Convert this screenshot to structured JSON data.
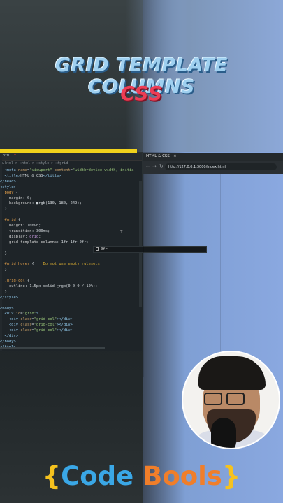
{
  "title": {
    "line1": "GRID TEMPLATE COLUMNS",
    "line2": "CSS"
  },
  "editor": {
    "tabs": [
      ".html",
      "x"
    ],
    "breadcrumb": "x.html > ☉html > ☉style > ☉#grid",
    "lines": [
      [
        {
          "c": "t-tag",
          "t": "  <meta "
        },
        {
          "c": "t-attr",
          "t": "name"
        },
        {
          "c": "",
          "t": "="
        },
        {
          "c": "t-str",
          "t": "\"viewport\""
        },
        {
          "c": "",
          "t": " "
        },
        {
          "c": "t-attr",
          "t": "content"
        },
        {
          "c": "",
          "t": "="
        },
        {
          "c": "t-str",
          "t": "\"width=device-width, initia"
        }
      ],
      [
        {
          "c": "t-tag",
          "t": "  <title>"
        },
        {
          "c": "",
          "t": "HTML & CSS"
        },
        {
          "c": "t-tag",
          "t": "</title>"
        }
      ],
      [
        {
          "c": "t-tag",
          "t": "</head>"
        }
      ],
      [
        {
          "c": "t-tag",
          "t": "<style>"
        }
      ],
      [
        {
          "c": "t-sel",
          "t": "  body"
        },
        {
          "c": "",
          "t": " {"
        }
      ],
      [
        {
          "c": "t-prop",
          "t": "    margin"
        },
        {
          "c": "",
          "t": ": 0;"
        }
      ],
      [
        {
          "c": "t-prop",
          "t": "    background"
        },
        {
          "c": "",
          "t": ": ■rgb(130, 180, 249);"
        }
      ],
      [
        {
          "c": "",
          "t": "  }"
        }
      ],
      [
        {
          "c": "",
          "t": ""
        }
      ],
      [
        {
          "c": "t-sel",
          "t": "  #grid"
        },
        {
          "c": "",
          "t": " {"
        }
      ],
      [
        {
          "c": "t-prop",
          "t": "    height"
        },
        {
          "c": "",
          "t": ": 100vh;"
        }
      ],
      [
        {
          "c": "t-prop",
          "t": "    transition"
        },
        {
          "c": "",
          "t": ": 300ms;"
        }
      ],
      [
        {
          "c": "t-prop",
          "t": "    display"
        },
        {
          "c": "",
          "t": ": "
        },
        {
          "c": "t-val",
          "t": "grid"
        },
        {
          "c": "",
          "t": ";"
        }
      ],
      [
        {
          "c": "t-prop",
          "t": "    grid-template-columns"
        },
        {
          "c": "",
          "t": ": 1fr 1fr 0fr;"
        }
      ],
      [
        {
          "c": "",
          "t": ""
        }
      ],
      [
        {
          "c": "",
          "t": "  }"
        }
      ],
      [
        {
          "c": "",
          "t": ""
        }
      ],
      [
        {
          "c": "t-sel",
          "t": "  #grid:hover"
        },
        {
          "c": "",
          "t": " {"
        },
        {
          "c": "t-warn",
          "t": "    Do not use empty rulesets"
        }
      ],
      [
        {
          "c": "",
          "t": "  }"
        }
      ],
      [
        {
          "c": "",
          "t": ""
        }
      ],
      [
        {
          "c": "t-sel",
          "t": "  .grid-col"
        },
        {
          "c": "",
          "t": " {"
        }
      ],
      [
        {
          "c": "t-prop",
          "t": "    outline"
        },
        {
          "c": "",
          "t": ": 1.5px solid □rgb(0 0 0 / 10%);"
        }
      ],
      [
        {
          "c": "",
          "t": "  }"
        }
      ],
      [
        {
          "c": "t-tag",
          "t": "</style>"
        }
      ],
      [
        {
          "c": "",
          "t": ""
        }
      ],
      [
        {
          "c": "t-tag",
          "t": "<body>"
        }
      ],
      [
        {
          "c": "t-tag",
          "t": "  <div "
        },
        {
          "c": "t-attr",
          "t": "id"
        },
        {
          "c": "",
          "t": "="
        },
        {
          "c": "t-str",
          "t": "\"grid\""
        },
        {
          "c": "t-tag",
          "t": ">"
        }
      ],
      [
        {
          "c": "t-tag",
          "t": "    <div "
        },
        {
          "c": "t-attr",
          "t": "class"
        },
        {
          "c": "",
          "t": "="
        },
        {
          "c": "t-str",
          "t": "\"grid-col\""
        },
        {
          "c": "t-tag",
          "t": "></div>"
        }
      ],
      [
        {
          "c": "t-tag",
          "t": "    <div "
        },
        {
          "c": "t-attr",
          "t": "class"
        },
        {
          "c": "",
          "t": "="
        },
        {
          "c": "t-str",
          "t": "\"grid-col\""
        },
        {
          "c": "t-tag",
          "t": "></div>"
        }
      ],
      [
        {
          "c": "t-tag",
          "t": "    <div "
        },
        {
          "c": "t-attr",
          "t": "class"
        },
        {
          "c": "",
          "t": "="
        },
        {
          "c": "t-str",
          "t": "\"grid-col\""
        },
        {
          "c": "t-tag",
          "t": "></div>"
        }
      ],
      [
        {
          "c": "t-tag",
          "t": "  </div>"
        }
      ],
      [
        {
          "c": "t-tag",
          "t": "</body>"
        }
      ],
      [
        {
          "c": "t-tag",
          "t": "</html>"
        }
      ]
    ],
    "suggestion": "0fr"
  },
  "browser": {
    "tab_label": "HTML & CSS",
    "tab_close": "×",
    "url": "http://127.0.0.1:3000/index.html"
  },
  "logo": {
    "open": "{",
    "code": "Code",
    "bools": " Bools",
    "close": "}"
  },
  "colors": {
    "page_background": "#82b4f9",
    "title_blue": "#9fd0f0",
    "title_red": "#ee3d55"
  }
}
